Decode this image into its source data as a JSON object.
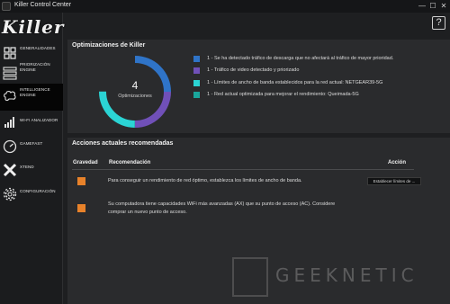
{
  "window": {
    "title": "Killer Control Center",
    "minimize": "—",
    "maximize": "☐",
    "close": "✕"
  },
  "logo": "Killer",
  "sidebar": {
    "items": [
      {
        "label": "GENERALIDADES",
        "icon": "grid-icon"
      },
      {
        "label": "PRIORIZACIÓN ENGINE",
        "icon": "priority-list-icon"
      },
      {
        "label": "INTELLIGENCE ENGINE",
        "icon": "brain-icon",
        "active": true
      },
      {
        "label": "WI-FI ANALIZADOR",
        "icon": "wifi-icon"
      },
      {
        "label": "GAMEFAST",
        "icon": "speedometer-icon"
      },
      {
        "label": "XTEND",
        "icon": "x-icon"
      },
      {
        "label": "CONFIGURACIÓN",
        "icon": "gear-icon"
      }
    ]
  },
  "help": "?",
  "optimizations": {
    "title": "Optimizaciones de Killer",
    "count": "4",
    "count_label": "Optimizaciones",
    "colors": {
      "blue": "#2f74c8",
      "purple": "#7050b8",
      "cyan": "#2bd4d4",
      "teal": "#1aa69c"
    },
    "items": [
      {
        "text": "1 - Se ha detectado tráfico de descarga que no afectará al tráfico de mayor prioridad.",
        "color": "#2f74c8"
      },
      {
        "text": "1 - Tráfico de video detectado y priorizado",
        "color": "#7050b8"
      },
      {
        "text": "1 - Límites de ancho de banda establecidos para la red actual: NETGEAR39-5G",
        "color": "#2bd4d4"
      },
      {
        "text": "1 - Red actual optimizada para mejorar el rendimiento: Queimada-5G",
        "color": "#1aa69c"
      }
    ]
  },
  "recommendations": {
    "title": "Acciones actuales recomendadas",
    "headers": {
      "severity": "Gravedad",
      "recommendation": "Recomendación",
      "action": "Acción"
    },
    "warning_color": "#e8822a",
    "rows": [
      {
        "text": "Para conseguir un rendimiento de red óptimo, establezca los límites de ancho de banda.",
        "action": "Establecer límites de ..."
      },
      {
        "text_line1": "Su computadora tiene capacidades WiFi más avanzadas (AX) que su punto de acceso (AC). Considere",
        "text_line2": "comprar un nuevo punto de acceso."
      }
    ]
  },
  "watermark": "GEEKNETIC"
}
